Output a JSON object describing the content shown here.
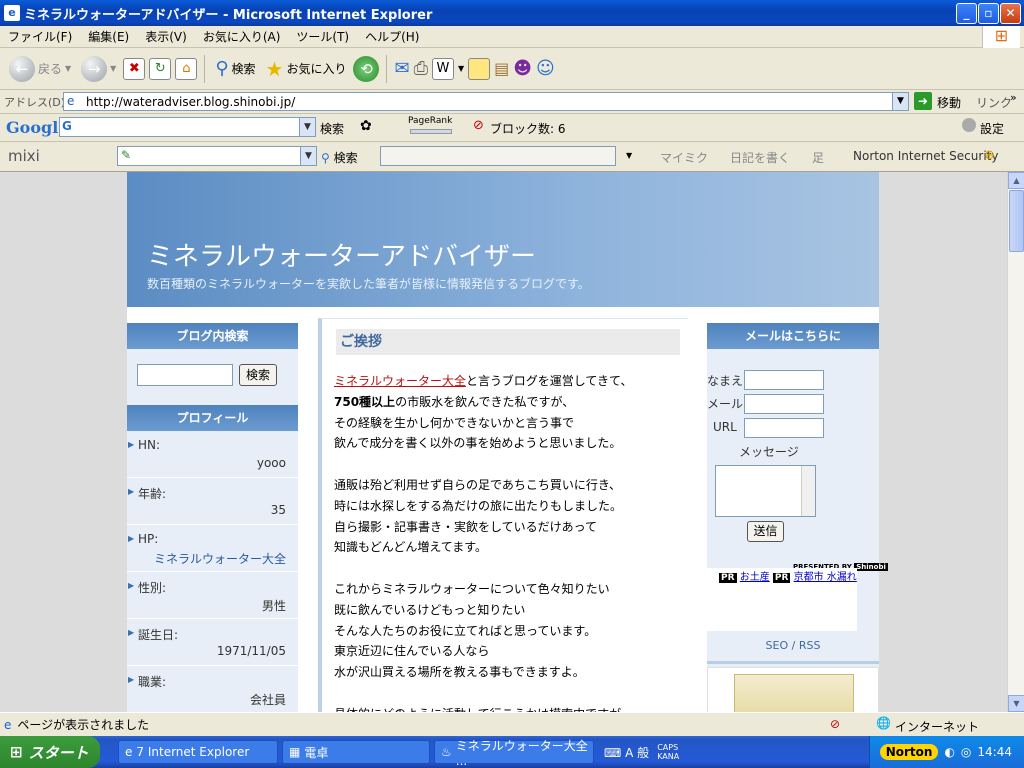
{
  "window": {
    "title": "ミネラルウォーターアドバイザー - Microsoft Internet Explorer",
    "menu": [
      "ファイル(F)",
      "編集(E)",
      "表示(V)",
      "お気に入り(A)",
      "ツール(T)",
      "ヘルプ(H)"
    ]
  },
  "toolbar": {
    "back": "戻る",
    "search": "検索",
    "favorites": "お気に入り"
  },
  "address": {
    "label": "アドレス(D)",
    "url": "http://wateradviser.blog.shinobi.jp/",
    "go": "移動",
    "links": "リンク"
  },
  "google": {
    "logo": "Google",
    "search": "検索",
    "pagerank": "PageRank",
    "blocked": "ブロック数: 6",
    "settings": "設定"
  },
  "mixi": {
    "logo": "mixi",
    "search": "検索",
    "mymixi": "マイミク",
    "diary": "日記を書く",
    "ashiato": "足",
    "norton": "Norton Internet Security"
  },
  "page": {
    "title": "ミネラルウォーターアドバイザー",
    "subtitle": "数百種類のミネラルウォーターを実飲した筆者が皆様に情報発信するブログです。",
    "left": {
      "search_head": "ブログ内検索",
      "search_btn": "検索",
      "profile_head": "プロフィール",
      "rows": [
        {
          "k": "HN:",
          "v": "yooo"
        },
        {
          "k": "年齢:",
          "v": "35"
        },
        {
          "k": "HP:",
          "v": "ミネラルウォーター大全"
        },
        {
          "k": "性別:",
          "v": "男性"
        },
        {
          "k": "誕生日:",
          "v": "1971/11/05"
        },
        {
          "k": "職業:",
          "v": "会社員"
        }
      ]
    },
    "main": {
      "heading": "ご挨拶",
      "link": "ミネラルウォーター大全",
      "l1rest": "と言うブログを運営してきて、",
      "l2bold": "750種以上",
      "l2rest": "の市販水を飲んできた私ですが、",
      "lines": [
        "その経験を生かし何かできないかと言う事で",
        "飲んで成分を書く以外の事を始めようと思いました。",
        "",
        "通販は殆ど利用せず自らの足であちこち買いに行き、",
        "時には水探しをする為だけの旅に出たりもしました。",
        "自ら撮影・記事書き・実飲をしているだけあって",
        "知識もどんどん増えてます。",
        "",
        "これからミネラルウォーターについて色々知りたい",
        "既に飲んでいるけどもっと知りたい",
        "そんな人たちのお役に立てればと思っています。",
        "東京近辺に住んでいる人なら",
        "水が沢山買える場所を教える事もできますよ。",
        "",
        "具体的にどのように活動して行こうかは模索中ですが、"
      ]
    },
    "right": {
      "head": "メールはこちらに",
      "name": "なまえ",
      "mail": "メール",
      "url": "URL",
      "message": "メッセージ",
      "send": "送信",
      "presented": "PRESENTED BY",
      "presented_brand": "Shinobi",
      "pr1": "お土産",
      "pr2": "京都市 水漏れ",
      "pr_badge": "PR",
      "seo": "SEO / RSS"
    }
  },
  "status": {
    "text": "ページが表示されました",
    "zone": "インターネット"
  },
  "taskbar": {
    "start": "スタート",
    "tasks": [
      "7 Internet Explorer",
      "電卓",
      "ミネラルウォーター大全 ..."
    ],
    "ime": "般",
    "caps": "CAPS",
    "kana": "KANA",
    "norton": "Norton",
    "clock": "14:44"
  }
}
